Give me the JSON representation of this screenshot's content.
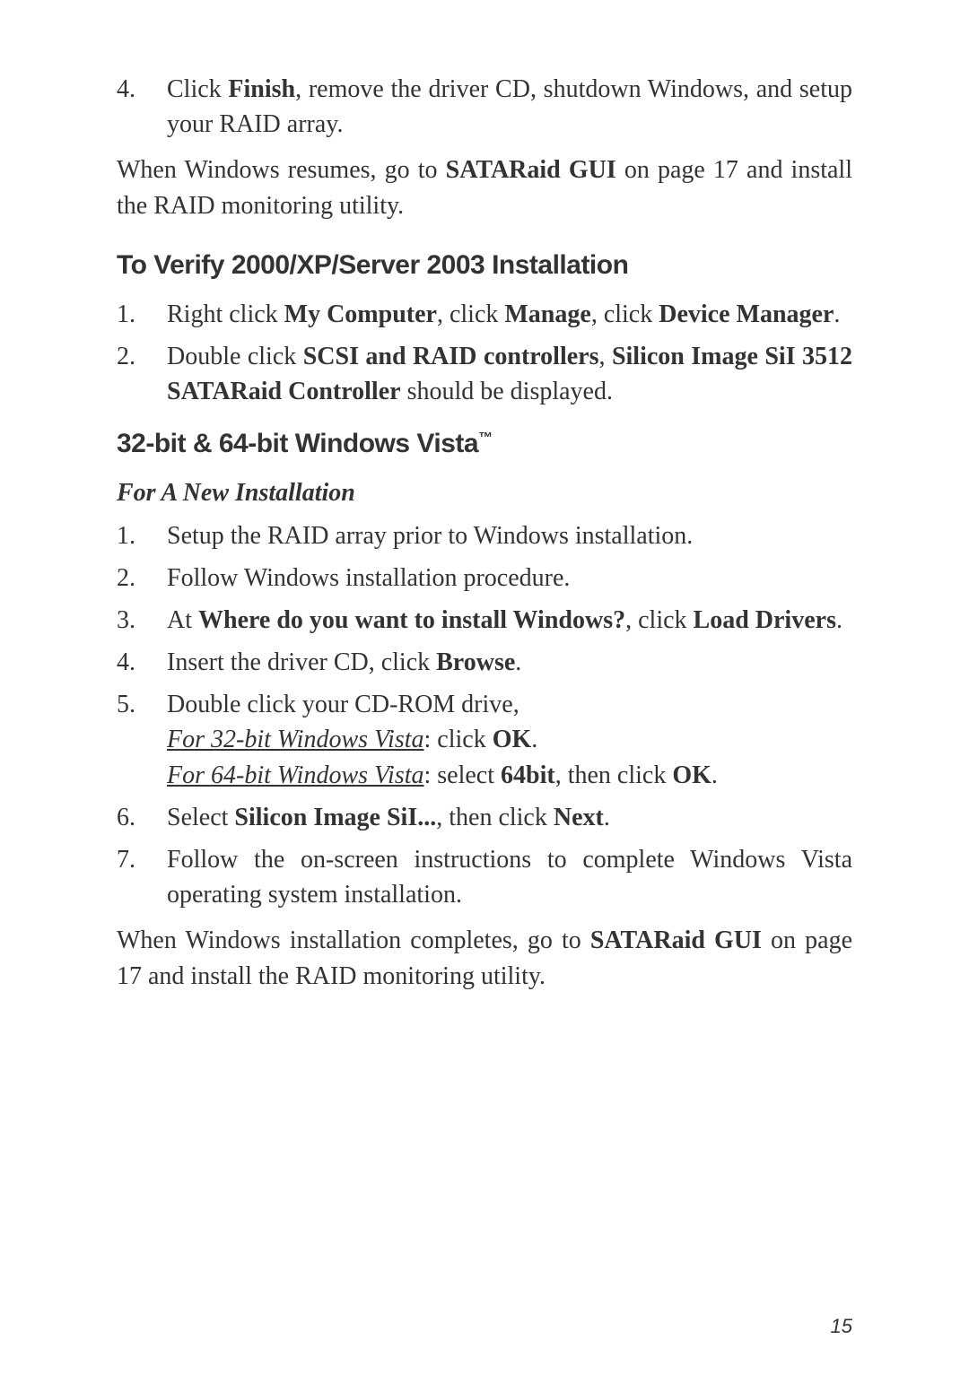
{
  "step4": {
    "num": "4.",
    "prefix": "Click ",
    "bold1": "Finish",
    "suffix": ", remove the driver CD, shutdown Windows, and setup your RAID array."
  },
  "para1": {
    "prefix": "When Windows resumes, go to ",
    "bold1": "SATARaid GUI",
    "suffix": " on page 17 and install the RAID monitoring utility."
  },
  "heading1": "To Verify 2000/XP/Server 2003 Installation",
  "verify1": {
    "num": "1.",
    "t1": "Right click ",
    "b1": "My Computer",
    "t2": ", click ",
    "b2": "Manage",
    "t3": ", click ",
    "b3": "Device Manager",
    "t4": "."
  },
  "verify2": {
    "num": "2.",
    "t1": "Double click ",
    "b1": "SCSI and RAID controllers",
    "t2": ", ",
    "b2": "Silicon Image SiI 3512 SATARaid Controller",
    "t3": " should be displayed."
  },
  "heading2": "32-bit & 64-bit Windows Vista",
  "tm": "™",
  "subheading": "For A New Installation",
  "vista1": {
    "num": "1.",
    "text": "Setup the RAID array prior to Windows installation."
  },
  "vista2": {
    "num": "2.",
    "text": "Follow Windows installation procedure."
  },
  "vista3": {
    "num": "3.",
    "t1": "At ",
    "b1": "Where do you want to install Windows?",
    "t2": ", click ",
    "b2": "Load Drivers",
    "t3": "."
  },
  "vista4": {
    "num": "4.",
    "t1": "Insert the driver CD, click ",
    "b1": "Browse",
    "t2": "."
  },
  "vista5": {
    "num": "5.",
    "line1": "Double click your CD-ROM drive,",
    "u1": "For 32-bit Windows Vista",
    "t1": ":  click ",
    "b1": "OK",
    "t2": ".",
    "u2": "For 64-bit Windows Vista",
    "t3": ":  select ",
    "b2": "64bit",
    "t4": ", then click ",
    "b3": "OK",
    "t5": "."
  },
  "vista6": {
    "num": "6.",
    "t1": "Select ",
    "b1": "Silicon Image SiI...",
    "t2": ", then click ",
    "b2": "Next",
    "t3": "."
  },
  "vista7": {
    "num": "7.",
    "text": "Follow the on-screen instructions to complete Windows Vista operating system installation."
  },
  "para2": {
    "t1": "When Windows installation completes, go to ",
    "b1": "SATARaid GUI",
    "t2": " on page 17 and install the RAID monitoring utility."
  },
  "pageNum": "15"
}
